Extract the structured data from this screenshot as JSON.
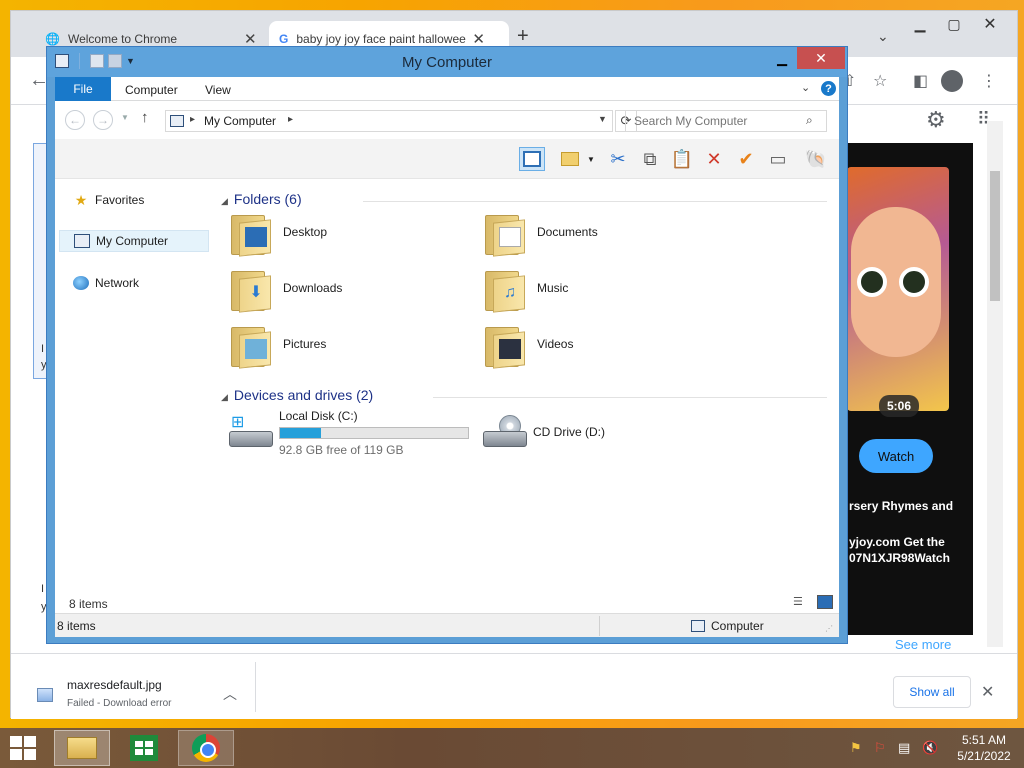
{
  "chrome": {
    "tabs": [
      {
        "title": "Welcome to Chrome"
      },
      {
        "title": "baby joy joy face paint halloween"
      }
    ],
    "new_tab_label": "+",
    "youtube": {
      "duration": "5:06",
      "watch_label": "Watch",
      "text1": "rsery Rhymes and",
      "text2": "yjoy.com Get the",
      "text3": "07N1XJR98Watch",
      "see_more": "See more"
    },
    "downloads": {
      "filename": "maxresdefault.jpg",
      "status": "Failed - Download error",
      "show_all": "Show all"
    },
    "left_fragments": [
      "I",
      "y",
      "I",
      "y"
    ]
  },
  "explorer": {
    "title": "My Computer",
    "ribbon": {
      "file": "File",
      "computer": "Computer",
      "view": "View"
    },
    "address": "My Computer",
    "search_placeholder": "Search My Computer",
    "nav": {
      "favorites": "Favorites",
      "my_computer": "My Computer",
      "network": "Network"
    },
    "groups": {
      "folders": "Folders (6)",
      "drives": "Devices and drives (2)"
    },
    "folders": [
      "Desktop",
      "Documents",
      "Downloads",
      "Music",
      "Pictures",
      "Videos"
    ],
    "drives": {
      "c": {
        "name": "Local Disk (C:)",
        "free": "92.8 GB free of 119 GB",
        "used_fraction": 0.22
      },
      "d": {
        "name": "CD Drive (D:)"
      }
    },
    "item_count": "8 items",
    "status": {
      "count": "8 items",
      "location": "Computer"
    }
  },
  "taskbar": {
    "time": "5:51 AM",
    "date": "5/21/2022"
  }
}
